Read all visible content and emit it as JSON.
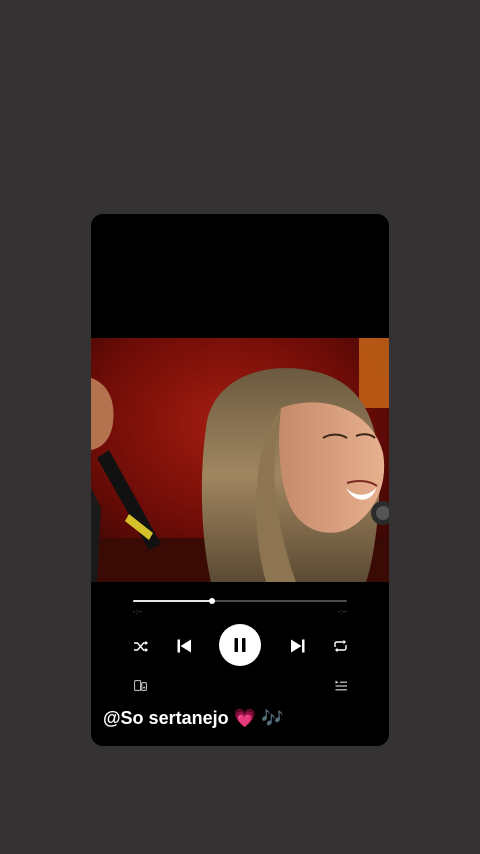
{
  "player": {
    "progress_fraction": 0.37,
    "elapsed_time": "-:--",
    "total_time": "-:--",
    "state": "playing"
  },
  "controls": {
    "shuffle": "shuffle-icon",
    "previous": "skip-previous-icon",
    "pause": "pause-icon",
    "next": "skip-next-icon",
    "repeat": "repeat-icon",
    "devices": "connect-device-icon",
    "queue": "queue-icon"
  },
  "caption": {
    "text": "@So sertanejo",
    "emoji_heart": "💗",
    "emoji_notes": "🎶"
  },
  "colors": {
    "background": "#343232",
    "card": "#000000",
    "accent": "#ffffff",
    "heart": "#ff4f9a",
    "notes": "#9b59ff"
  }
}
